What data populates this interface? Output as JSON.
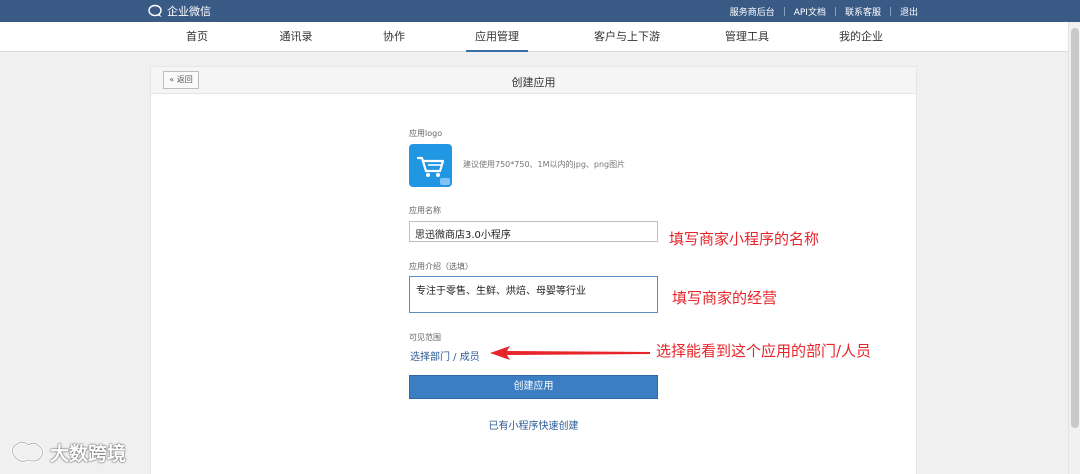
{
  "topbar": {
    "brand": "企业微信",
    "links": [
      "服务商后台",
      "API文档",
      "联系客服",
      "退出"
    ]
  },
  "nav": {
    "items": [
      "首页",
      "通讯录",
      "协作",
      "应用管理",
      "客户与上下游",
      "管理工具",
      "我的企业"
    ],
    "active": "应用管理"
  },
  "panel": {
    "back_label": "« 返回",
    "title": "创建应用"
  },
  "form": {
    "logo_label": "应用logo",
    "logo_hint": "建议使用750*750、1M以内的jpg、png图片",
    "logo_icon": "shopping-cart-icon",
    "name_label": "应用名称",
    "name_value": "思迅微商店3.0小程序",
    "intro_label": "应用介绍（选填）",
    "intro_value": "专注于零售、生鲜、烘焙、母婴等行业",
    "scope_label": "可见范围",
    "scope_link": "选择部门 / 成员",
    "create_button": "创建应用",
    "quick_create_link": "已有小程序快速创建"
  },
  "annotations": {
    "name_note": "填写商家小程序的名称",
    "intro_note": "填写商家的经营",
    "scope_note": "选择能看到这个应用的部门/人员"
  },
  "watermark": {
    "text": "大数跨境"
  },
  "colors": {
    "topbar": "#3a5a86",
    "accent": "#3c7ec2",
    "annotation": "#e6262b",
    "logo_bg": "#2196e3"
  }
}
